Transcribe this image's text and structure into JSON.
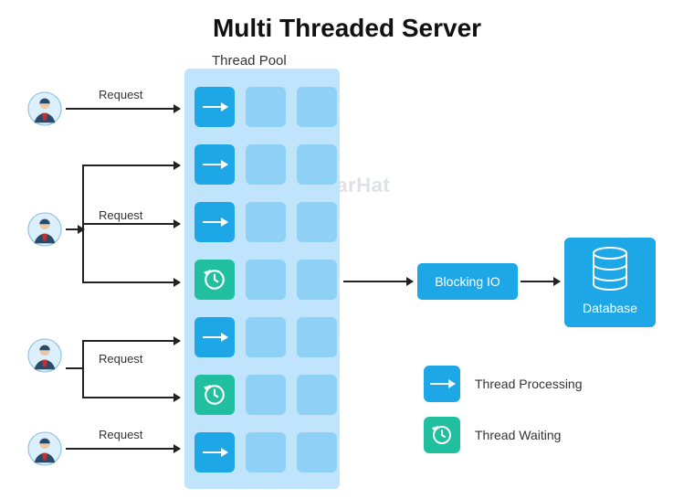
{
  "title": "Multi Threaded Server",
  "watermark": "ScholarHat",
  "pool_label": "Thread Pool",
  "request_label": "Request",
  "blocking_io_label": "Blocking IO",
  "database_label": "Database",
  "legend": {
    "processing": "Thread Processing",
    "waiting": "Thread Waiting"
  },
  "users_count": 4,
  "pool": {
    "rows": 7,
    "cols": 3,
    "cells": [
      [
        "proc",
        "empty",
        "empty"
      ],
      [
        "proc",
        "empty",
        "empty"
      ],
      [
        "proc",
        "empty",
        "empty"
      ],
      [
        "wait",
        "empty",
        "empty"
      ],
      [
        "proc",
        "empty",
        "empty"
      ],
      [
        "wait",
        "empty",
        "empty"
      ],
      [
        "proc",
        "empty",
        "empty"
      ]
    ]
  },
  "colors": {
    "pool_bg": "#bfe4fb",
    "empty": "#8fd0f7",
    "processing": "#1ea7e6",
    "waiting": "#1fbfa0",
    "arrow": "#222222"
  }
}
